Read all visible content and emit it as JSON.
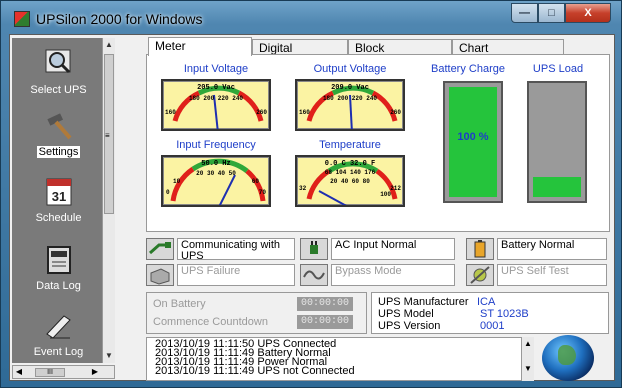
{
  "window": {
    "title": "UPSilon 2000 for Windows",
    "min": "—",
    "max": "□",
    "close": "X"
  },
  "sidebar": {
    "items": [
      {
        "label": "Select UPS",
        "icon": "magnifier-icon"
      },
      {
        "label": "Settings",
        "icon": "hammer-icon"
      },
      {
        "label": "Schedule",
        "icon": "calendar-icon"
      },
      {
        "label": "Data Log",
        "icon": "datalog-icon"
      },
      {
        "label": "Event Log",
        "icon": "pen-icon"
      }
    ],
    "calendar_day": "31",
    "scroll_grip": "≡",
    "hscroll_grip": "III"
  },
  "tabs": [
    "Meter",
    "Digital",
    "Block",
    "Chart"
  ],
  "meters": {
    "input_voltage": {
      "label": "Input Voltage",
      "reading": "205.0 Vac",
      "ticks": [
        "160",
        "180",
        "200",
        "220",
        "240",
        "260"
      ]
    },
    "output_voltage": {
      "label": "Output Voltage",
      "reading": "209.0 Vac",
      "ticks": [
        "160",
        "180",
        "200",
        "220",
        "240",
        "260"
      ]
    },
    "input_frequency": {
      "label": "Input Frequency",
      "reading": "50.0 Hz",
      "ticks": [
        "0",
        "10",
        "20",
        "30",
        "40",
        "50",
        "60",
        "70"
      ]
    },
    "temperature": {
      "label": "Temperature",
      "reading": "0.0 C   32.0 F",
      "ticks_c": [
        "68",
        "104",
        "140",
        "176"
      ],
      "ticks_f": [
        "32",
        "20",
        "40",
        "60",
        "80",
        "100",
        "212"
      ]
    },
    "battery_charge": {
      "label": "Battery Charge",
      "value_text": "100 %",
      "level_fraction": 1.0,
      "color": "#25c43c"
    },
    "ups_load": {
      "label": "UPS Load",
      "level_fraction": 0.18,
      "color": "#25c43c"
    }
  },
  "status": {
    "communicating": "Communicating with UPS",
    "ac_input": "AC Input Normal",
    "battery": "Battery Normal",
    "ups_failure": "UPS Failure",
    "bypass": "Bypass Mode",
    "self_test": "UPS Self Test"
  },
  "counters": {
    "on_battery_label": "On Battery",
    "on_battery_value": "00:00:00",
    "countdown_label": "Commence Countdown",
    "countdown_value": "00:00:00"
  },
  "ups_info": {
    "manufacturer_label": "UPS Manufacturer",
    "manufacturer_value": "ICA",
    "model_label": "UPS Model",
    "model_value": "ST 1023B",
    "version_label": "UPS Version",
    "version_value": "0001"
  },
  "event_log": [
    "2013/10/19 11:11:50  UPS Connected",
    "2013/10/19 11:11:49  Battery Normal",
    "2013/10/19 11:11:49  Power Normal",
    "2013/10/19 11:11:49  UPS not Connected"
  ],
  "colors": {
    "accent": "#1e3ec8",
    "meter_face": "#fbf3a3",
    "ok": "#25c43c"
  }
}
